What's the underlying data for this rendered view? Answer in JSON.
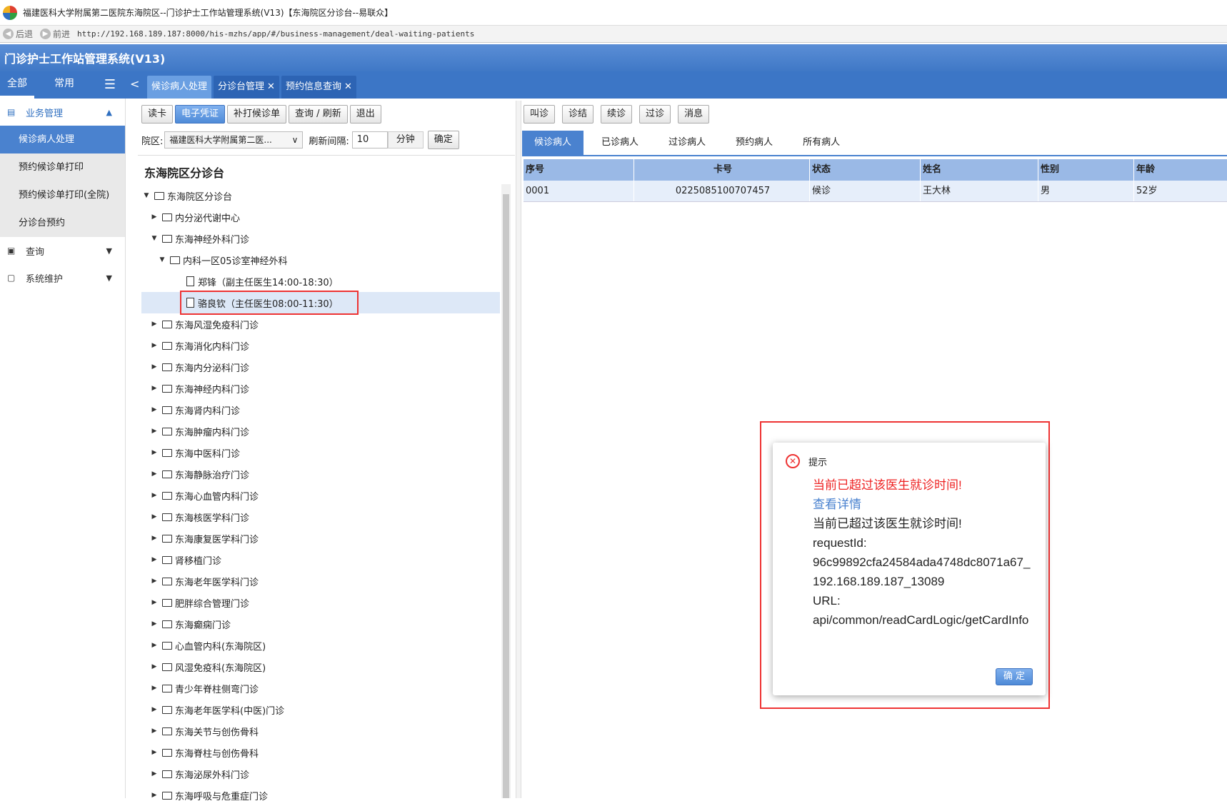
{
  "window": {
    "title": "福建医科大学附属第二医院东海院区--门诊护士工作站管理系统(V13)【东海院区分诊台--易联众】"
  },
  "browser": {
    "back": "后退",
    "forward": "前进",
    "url": "http://192.168.189.187:8000/his-mzhs/app/#/business-management/deal-waiting-patients"
  },
  "app": {
    "title": "门诊护士工作站管理系统(V13)"
  },
  "sidetabs": [
    "全部",
    "常用"
  ],
  "maintabs": [
    {
      "label": "候诊病人处理",
      "active": true
    },
    {
      "label": "分诊台管理",
      "closable": true
    },
    {
      "label": "预约信息查询",
      "closable": true
    }
  ],
  "sidebar": {
    "groups": [
      {
        "label": "业务管理",
        "icon": "briefcase-icon",
        "open": true,
        "items": [
          {
            "label": "候诊病人处理",
            "active": true
          },
          {
            "label": "预约候诊单打印"
          },
          {
            "label": "预约候诊单打印(全院)"
          },
          {
            "label": "分诊台预约"
          }
        ]
      },
      {
        "label": "查询",
        "icon": "search-doc-icon",
        "open": false
      },
      {
        "label": "系统维护",
        "icon": "monitor-icon",
        "open": false
      }
    ]
  },
  "left_toolbar": [
    "读卡",
    "电子凭证",
    "补打候诊单",
    "查询 / 刷新",
    "退出"
  ],
  "filter": {
    "campus_label": "院区:",
    "campus_value": "福建医科大学附属第二医...",
    "interval_label": "刷新间隔:",
    "interval_value": "10",
    "unit": "分钟",
    "confirm": "确定"
  },
  "tree": {
    "title": "东海院区分诊台",
    "nodes": [
      {
        "label": "东海院区分诊台",
        "level": 0,
        "type": "folder",
        "expanded": true
      },
      {
        "label": "内分泌代谢中心",
        "level": 1,
        "type": "folder"
      },
      {
        "label": "东海神经外科门诊",
        "level": 1,
        "type": "folder",
        "expanded": true
      },
      {
        "label": "内科一区05诊室神经外科",
        "level": 2,
        "type": "folder",
        "expanded": true
      },
      {
        "label": "郑锋（副主任医生14:00-18:30）",
        "level": 3,
        "type": "file"
      },
      {
        "label": "骆良钦（主任医生08:00-11:30）",
        "level": 3,
        "type": "file",
        "selected": true
      },
      {
        "label": "东海风湿免疫科门诊",
        "level": 1,
        "type": "folder"
      },
      {
        "label": "东海消化内科门诊",
        "level": 1,
        "type": "folder"
      },
      {
        "label": "东海内分泌科门诊",
        "level": 1,
        "type": "folder"
      },
      {
        "label": "东海神经内科门诊",
        "level": 1,
        "type": "folder"
      },
      {
        "label": "东海肾内科门诊",
        "level": 1,
        "type": "folder"
      },
      {
        "label": "东海肿瘤内科门诊",
        "level": 1,
        "type": "folder"
      },
      {
        "label": "东海中医科门诊",
        "level": 1,
        "type": "folder"
      },
      {
        "label": "东海静脉治疗门诊",
        "level": 1,
        "type": "folder"
      },
      {
        "label": "东海心血管内科门诊",
        "level": 1,
        "type": "folder"
      },
      {
        "label": "东海核医学科门诊",
        "level": 1,
        "type": "folder"
      },
      {
        "label": "东海康复医学科门诊",
        "level": 1,
        "type": "folder"
      },
      {
        "label": "肾移植门诊",
        "level": 1,
        "type": "folder"
      },
      {
        "label": "东海老年医学科门诊",
        "level": 1,
        "type": "folder"
      },
      {
        "label": "肥胖综合管理门诊",
        "level": 1,
        "type": "folder"
      },
      {
        "label": "东海癫痫门诊",
        "level": 1,
        "type": "folder"
      },
      {
        "label": "心血管内科(东海院区)",
        "level": 1,
        "type": "folder"
      },
      {
        "label": "风湿免疫科(东海院区)",
        "level": 1,
        "type": "folder"
      },
      {
        "label": "青少年脊柱侧弯门诊",
        "level": 1,
        "type": "folder"
      },
      {
        "label": "东海老年医学科(中医)门诊",
        "level": 1,
        "type": "folder"
      },
      {
        "label": "东海关节与创伤骨科",
        "level": 1,
        "type": "folder"
      },
      {
        "label": "东海脊柱与创伤骨科",
        "level": 1,
        "type": "folder"
      },
      {
        "label": "东海泌尿外科门诊",
        "level": 1,
        "type": "folder"
      },
      {
        "label": "东海呼吸与危重症门诊",
        "level": 1,
        "type": "folder"
      }
    ]
  },
  "right_toolbar": [
    "叫诊",
    "诊结",
    "续诊",
    "过诊",
    "消息"
  ],
  "subtabs": [
    {
      "label": "候诊病人",
      "active": true
    },
    {
      "label": "已诊病人"
    },
    {
      "label": "过诊病人"
    },
    {
      "label": "预约病人"
    },
    {
      "label": "所有病人"
    }
  ],
  "grid": {
    "columns": [
      "序号",
      "卡号",
      "状态",
      "姓名",
      "性别",
      "年龄"
    ],
    "rows": [
      [
        "0001",
        "0225085100707457",
        "候诊",
        "王大林",
        "男",
        "52岁"
      ]
    ]
  },
  "dialog": {
    "title": "提示",
    "error": "当前已超过该医生就诊时间!",
    "link": "查看详情",
    "detail": "当前已超过该医生就诊时间!",
    "request_label": "requestId:",
    "request_id": "96c99892cfa24584ada4748dc8071a67_192.168.189.187_13089",
    "url_label": "URL:",
    "url": "api/common/readCardLogic/getCardInfo",
    "ok": "确 定"
  }
}
